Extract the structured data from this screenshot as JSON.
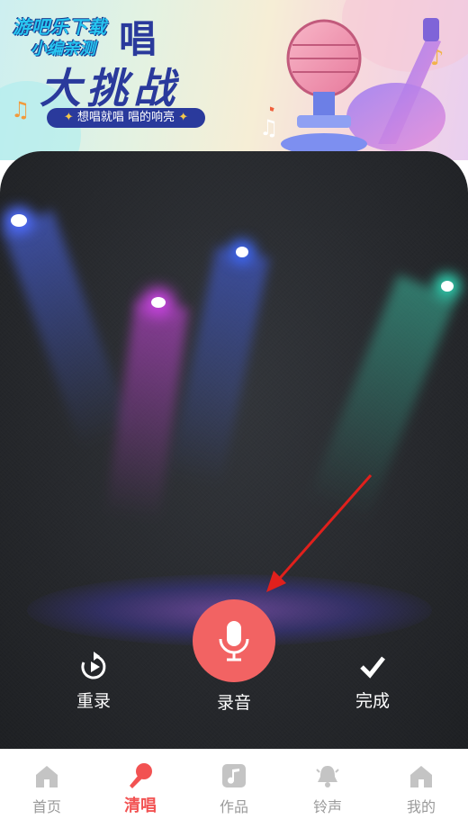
{
  "banner": {
    "watermark_line1": "游吧乐下载",
    "watermark_line2": "小编亲测",
    "title_top": "唱",
    "title_main": "大挑战",
    "slogan": "想唱就唱 唱的响亮",
    "slogan_star": "✦"
  },
  "controls": {
    "rerecord_label": "重录",
    "record_label": "录音",
    "finish_label": "完成"
  },
  "tabs": [
    {
      "label": "首页",
      "icon": "home-icon"
    },
    {
      "label": "清唱",
      "icon": "mic-icon"
    },
    {
      "label": "作品",
      "icon": "music-note-icon"
    },
    {
      "label": "铃声",
      "icon": "bell-icon"
    },
    {
      "label": "我的",
      "icon": "profile-home-icon"
    }
  ],
  "active_tab": 1,
  "colors": {
    "accent": "#f26363",
    "active_tab": "#f25252",
    "inactive_tab": "#9a9a9a",
    "title_blue": "#2a3a9c",
    "stage_bg": "#26282c",
    "arrow": "#e0201c"
  }
}
